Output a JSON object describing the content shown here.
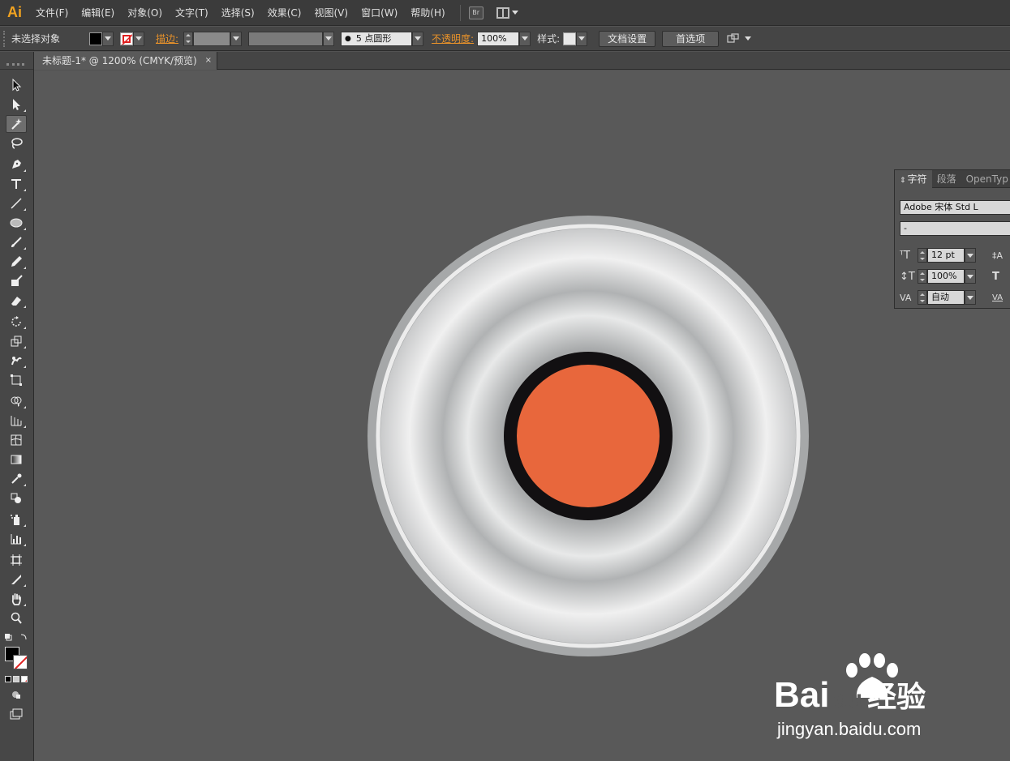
{
  "app": {
    "logo": "Ai",
    "accent": "#f0a220"
  },
  "menu": {
    "items": [
      "文件(F)",
      "编辑(E)",
      "对象(O)",
      "文字(T)",
      "选择(S)",
      "效果(C)",
      "视图(V)",
      "窗口(W)",
      "帮助(H)"
    ],
    "bridge_label": "Br"
  },
  "control_bar": {
    "selection_status": "未选择对象",
    "stroke_label": "描边:",
    "brush_value": "5 点圆形",
    "opacity_label": "不透明度:",
    "opacity_value": "100%",
    "style_label": "样式:",
    "doc_setup_button": "文档设置",
    "prefs_button": "首选项",
    "fill_color": "#000000",
    "stroke_color": "#ffffff"
  },
  "document_tab": {
    "title": "未标题-1* @ 1200% (CMYK/预览)",
    "close_glyph": "×"
  },
  "toolbox": {
    "tools": [
      "selection-tool",
      "direct-selection-tool",
      "magic-wand-tool",
      "lasso-tool",
      "pen-tool",
      "type-tool",
      "line-tool",
      "ellipse-tool",
      "paintbrush-tool",
      "pencil-tool",
      "blob-brush-tool",
      "eraser-tool",
      "rotate-tool",
      "scale-tool",
      "warp-tool",
      "free-transform-tool",
      "shape-builder-tool",
      "perspective-grid-tool",
      "mesh-tool",
      "gradient-tool",
      "eyedropper-tool",
      "blend-tool",
      "symbol-sprayer-tool",
      "column-graph-tool",
      "artboard-tool",
      "slice-tool",
      "hand-tool",
      "zoom-tool"
    ],
    "active_tool": "magic-wand-tool"
  },
  "artwork": {
    "outer_ring_color": "#a6a8a9",
    "highlight_ring_color": "#ececec",
    "gradient_colors": [
      "#9a9c9d",
      "#e8e9e9",
      "#b0b2b3",
      "#f0f0f0",
      "#c9cacb"
    ],
    "center_border_color": "#121012",
    "center_fill_color": "#e8673c"
  },
  "character_panel": {
    "tabs": [
      "字符",
      "段落",
      "OpenTyp"
    ],
    "font_family": "Adobe 宋体 Std L",
    "font_style": "-",
    "font_size": "12 pt",
    "vertical_scale": "100%",
    "tracking": "自动"
  },
  "watermark": {
    "brand": "Bai",
    "brand_suffix": "du",
    "brand_cn": "经验",
    "url": "jingyan.baidu.com"
  }
}
